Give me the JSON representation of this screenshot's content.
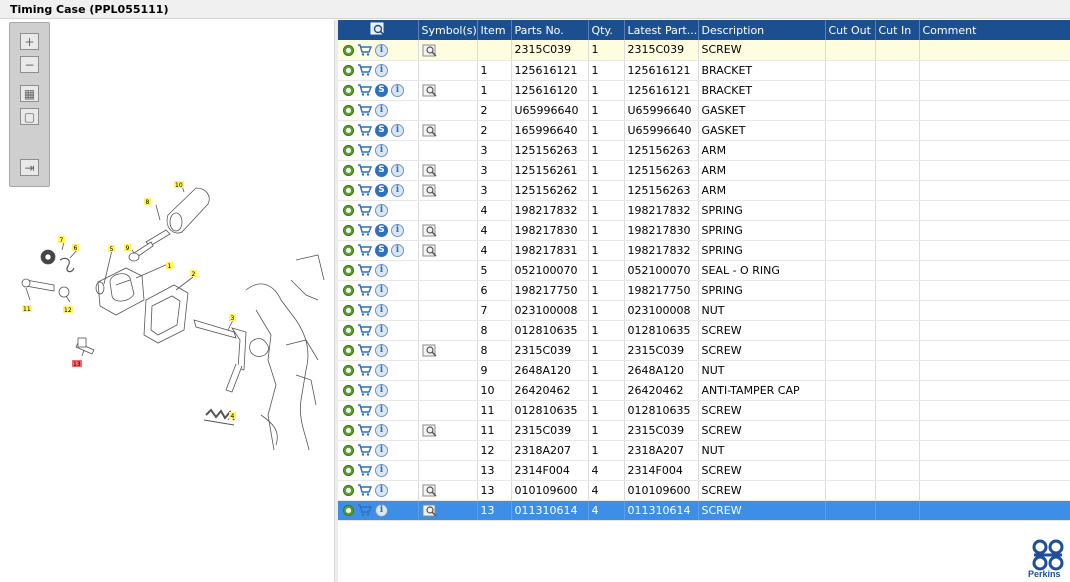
{
  "window": {
    "title": "Timing Case (PPL055111)"
  },
  "zoom_toolbar": {
    "buttons": [
      {
        "name": "zoom-in-icon",
        "glyph": "+"
      },
      {
        "name": "zoom-out-icon",
        "glyph": "−"
      },
      {
        "name": "fit-all-icon",
        "glyph": "▦"
      },
      {
        "name": "actual-size-icon",
        "glyph": "▢"
      },
      {
        "name": "sync-list-icon",
        "glyph": "⇥"
      }
    ]
  },
  "diagram": {
    "callouts": [
      "1",
      "2",
      "3",
      "4",
      "5",
      "6",
      "7",
      "8",
      "9",
      "10",
      "11",
      "12",
      "13"
    ]
  },
  "table": {
    "columns": {
      "icons": "",
      "symbols": "Symbol(s)",
      "item": "Item",
      "parts_no": "Parts No.",
      "qty": "Qty.",
      "latest_part": "Latest Part...",
      "description": "Description",
      "cut_out": "Cut Out",
      "cut_in": "Cut In",
      "comment": "Comment"
    },
    "rows": [
      {
        "s": false,
        "sym": true,
        "item": "",
        "part": "2315C039",
        "qty": "1",
        "latest": "2315C039",
        "desc": "SCREW",
        "hl": "yellow"
      },
      {
        "s": false,
        "sym": false,
        "item": "1",
        "part": "125616121",
        "qty": "1",
        "latest": "125616121",
        "desc": "BRACKET"
      },
      {
        "s": true,
        "sym": true,
        "item": "1",
        "part": "125616120",
        "qty": "1",
        "latest": "125616121",
        "desc": "BRACKET"
      },
      {
        "s": false,
        "sym": false,
        "item": "2",
        "part": "U65996640",
        "qty": "1",
        "latest": "U65996640",
        "desc": "GASKET"
      },
      {
        "s": true,
        "sym": true,
        "item": "2",
        "part": "165996640",
        "qty": "1",
        "latest": "U65996640",
        "desc": "GASKET"
      },
      {
        "s": false,
        "sym": false,
        "item": "3",
        "part": "125156263",
        "qty": "1",
        "latest": "125156263",
        "desc": "ARM"
      },
      {
        "s": true,
        "sym": true,
        "item": "3",
        "part": "125156261",
        "qty": "1",
        "latest": "125156263",
        "desc": "ARM"
      },
      {
        "s": true,
        "sym": true,
        "item": "3",
        "part": "125156262",
        "qty": "1",
        "latest": "125156263",
        "desc": "ARM"
      },
      {
        "s": false,
        "sym": false,
        "item": "4",
        "part": "198217832",
        "qty": "1",
        "latest": "198217832",
        "desc": "SPRING"
      },
      {
        "s": true,
        "sym": true,
        "item": "4",
        "part": "198217830",
        "qty": "1",
        "latest": "198217830",
        "desc": "SPRING"
      },
      {
        "s": true,
        "sym": true,
        "item": "4",
        "part": "198217831",
        "qty": "1",
        "latest": "198217832",
        "desc": "SPRING"
      },
      {
        "s": false,
        "sym": false,
        "item": "5",
        "part": "052100070",
        "qty": "1",
        "latest": "052100070",
        "desc": "SEAL - O RING"
      },
      {
        "s": false,
        "sym": false,
        "item": "6",
        "part": "198217750",
        "qty": "1",
        "latest": "198217750",
        "desc": "SPRING"
      },
      {
        "s": false,
        "sym": false,
        "item": "7",
        "part": "023100008",
        "qty": "1",
        "latest": "023100008",
        "desc": "NUT"
      },
      {
        "s": false,
        "sym": false,
        "item": "8",
        "part": "012810635",
        "qty": "1",
        "latest": "012810635",
        "desc": "SCREW"
      },
      {
        "s": false,
        "sym": true,
        "item": "8",
        "part": "2315C039",
        "qty": "1",
        "latest": "2315C039",
        "desc": "SCREW"
      },
      {
        "s": false,
        "sym": false,
        "item": "9",
        "part": "2648A120",
        "qty": "1",
        "latest": "2648A120",
        "desc": "NUT"
      },
      {
        "s": false,
        "sym": false,
        "item": "10",
        "part": "26420462",
        "qty": "1",
        "latest": "26420462",
        "desc": "ANTI-TAMPER CAP"
      },
      {
        "s": false,
        "sym": false,
        "item": "11",
        "part": "012810635",
        "qty": "1",
        "latest": "012810635",
        "desc": "SCREW"
      },
      {
        "s": false,
        "sym": true,
        "item": "11",
        "part": "2315C039",
        "qty": "1",
        "latest": "2315C039",
        "desc": "SCREW"
      },
      {
        "s": false,
        "sym": false,
        "item": "12",
        "part": "2318A207",
        "qty": "1",
        "latest": "2318A207",
        "desc": "NUT"
      },
      {
        "s": false,
        "sym": false,
        "item": "13",
        "part": "2314F004",
        "qty": "4",
        "latest": "2314F004",
        "desc": "SCREW"
      },
      {
        "s": false,
        "sym": true,
        "item": "13",
        "part": "010109600",
        "qty": "4",
        "latest": "010109600",
        "desc": "SCREW"
      },
      {
        "s": false,
        "sym": true,
        "item": "13",
        "part": "011310614",
        "qty": "4",
        "latest": "011310614",
        "desc": "SCREW",
        "hl": "selected"
      }
    ]
  },
  "brand": {
    "name": "Perkins",
    "color": "#1f4f9b"
  },
  "colors": {
    "header": "#1b4f8f",
    "selected": "#3d8ee6",
    "highlight": "#fffde0"
  }
}
